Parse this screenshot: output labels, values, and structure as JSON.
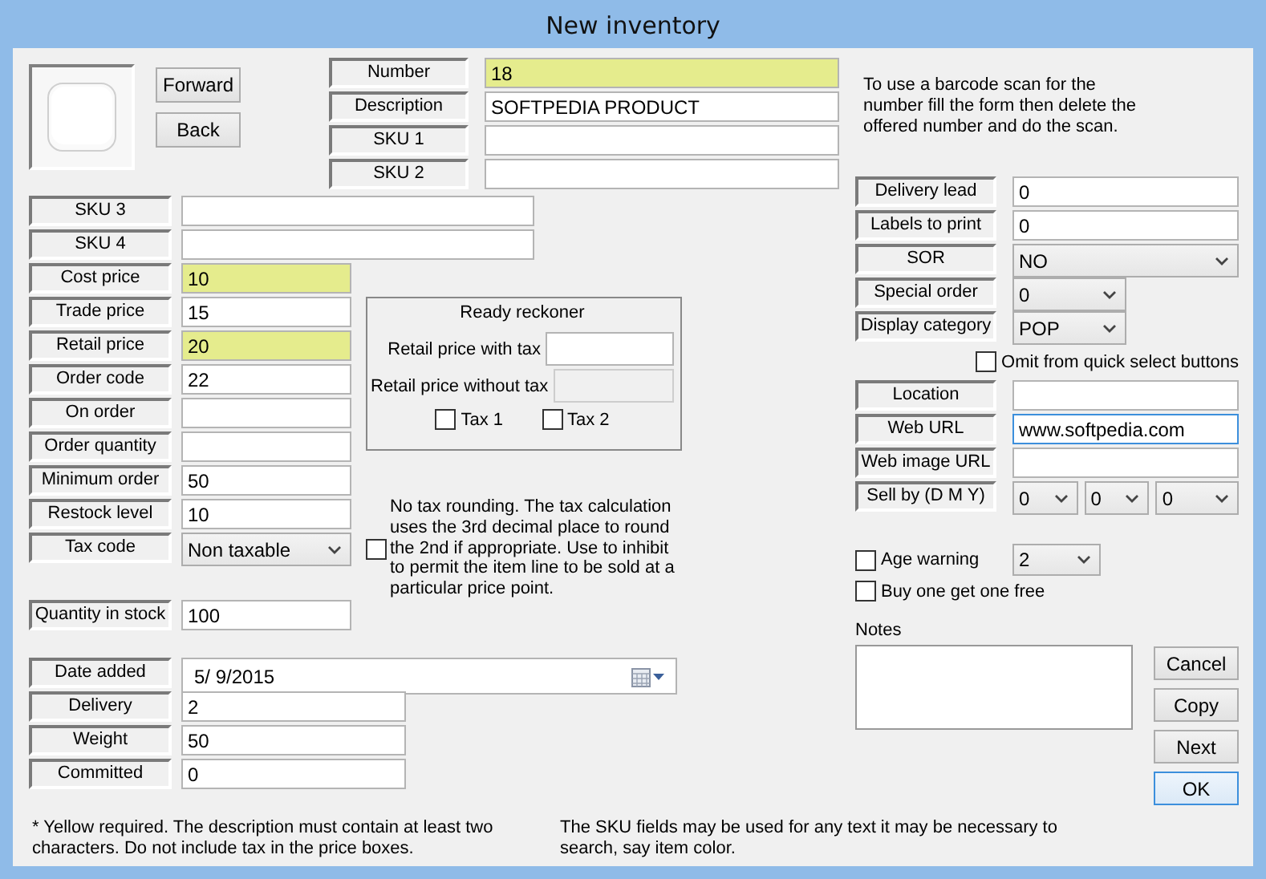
{
  "window": {
    "title": "New inventory"
  },
  "nav_buttons": [
    "Forward",
    "Back"
  ],
  "header_fields": [
    {
      "label": "Number",
      "value": "18",
      "required": true
    },
    {
      "label": "Description",
      "value": "SOFTPEDIA PRODUCT",
      "required": false
    },
    {
      "label": "SKU 1",
      "required": false
    },
    {
      "label": "SKU 2",
      "required": false
    }
  ],
  "barcode_hint": "To use a barcode scan for the number fill the form then delete the offered number and do the scan.",
  "sku_fields": [
    {
      "label": "SKU 3"
    },
    {
      "label": "SKU 4"
    }
  ],
  "price_fields": [
    {
      "label": "Cost price",
      "kind": "text",
      "value": "10",
      "required": true
    },
    {
      "label": "Trade price",
      "kind": "text",
      "value": "15",
      "required": false
    },
    {
      "label": "Retail price",
      "kind": "text",
      "value": "20",
      "required": true
    },
    {
      "label": "Order code",
      "kind": "text",
      "value": "22",
      "required": false
    },
    {
      "label": "On order",
      "kind": "text",
      "required": false
    },
    {
      "label": "Order quantity",
      "kind": "text",
      "required": false
    },
    {
      "label": "Minimum order",
      "kind": "text",
      "value": "50",
      "required": false
    },
    {
      "label": "Restock level",
      "kind": "text",
      "value": "10",
      "required": false
    },
    {
      "label": "Tax code",
      "kind": "select",
      "value": "Non taxable",
      "required": false
    }
  ],
  "ready_reckoner": {
    "title": "Ready reckoner",
    "rows": [
      {
        "label": "Retail price with tax",
        "disabled": false
      },
      {
        "label": "Retail price without tax",
        "disabled": true
      }
    ],
    "checkboxes": [
      {
        "label": "Tax 1",
        "checked": false
      },
      {
        "label": "Tax 2",
        "checked": false
      }
    ]
  },
  "no_tax_rounding": {
    "checked": false,
    "text": "No tax rounding. The tax calculation uses the 3rd decimal place to round the 2nd if appropriate. Use to inhibit to permit the item line to be sold at a particular price point."
  },
  "stock_field": {
    "label": "Quantity in stock",
    "value": "100"
  },
  "date_fields": [
    {
      "label": "Date added",
      "kind": "date",
      "value": "5/  9/2015"
    },
    {
      "label": "Delivery",
      "kind": "text",
      "value": "2"
    },
    {
      "label": "Weight",
      "kind": "text",
      "value": "50"
    },
    {
      "label": "Committed",
      "kind": "text",
      "value": "0"
    }
  ],
  "right_fields": [
    {
      "label": "Delivery lead",
      "kind": "text",
      "value": "0"
    },
    {
      "label": "Labels to print",
      "kind": "text",
      "value": "0"
    },
    {
      "label": "SOR",
      "kind": "select",
      "value": "NO"
    },
    {
      "label": "Special order",
      "kind": "miniselect",
      "value": "0"
    },
    {
      "label": "Display category",
      "kind": "miniselect",
      "value": "POP"
    }
  ],
  "omit_checkbox": {
    "label": "Omit from quick select buttons",
    "checked": false
  },
  "web_fields": [
    {
      "label": "Location",
      "focused": false
    },
    {
      "label": "Web URL",
      "value": "www.softpedia.com",
      "focused": true
    },
    {
      "label": "Web image URL",
      "focused": false
    }
  ],
  "sell_by": {
    "label": "Sell by (D M Y)",
    "values": [
      "0",
      "0",
      "0"
    ]
  },
  "age_warning": {
    "label": "Age warning",
    "checked": false,
    "value": "2"
  },
  "bogof": {
    "label": "Buy one get one free",
    "checked": false
  },
  "notes": {
    "label": "Notes"
  },
  "buttons": [
    {
      "label": "Cancel",
      "default": false
    },
    {
      "label": "Copy",
      "default": false
    },
    {
      "label": "Next",
      "default": false
    },
    {
      "label": "OK",
      "default": true
    }
  ],
  "footnotes": [
    "* Yellow required. The description must contain at least two characters. Do not include tax in the price boxes.",
    "The SKU fields may be used for any text it may be necessary to search, say item color."
  ]
}
